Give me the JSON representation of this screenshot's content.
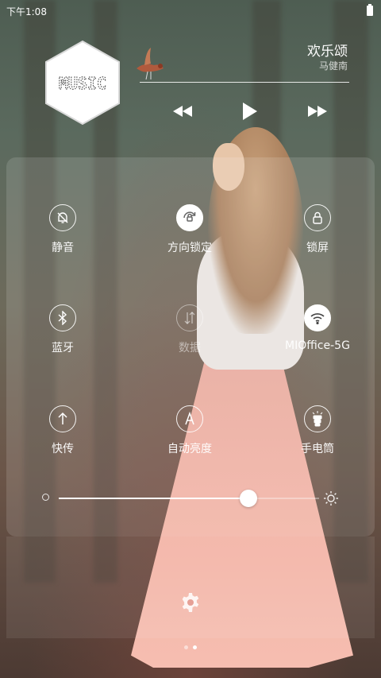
{
  "status_bar": {
    "time": "下午1:08"
  },
  "music": {
    "logo_text": "MUSIC",
    "title": "欢乐颂",
    "artist": "马健南",
    "controls": {
      "previous": "rewind-icon",
      "play": "play-icon",
      "next": "fast-forward-icon"
    }
  },
  "toggles": [
    {
      "label": "静音",
      "icon": "bell-mute-icon",
      "state": "off"
    },
    {
      "label": "方向锁定",
      "icon": "rotation-lock-icon",
      "state": "on"
    },
    {
      "label": "锁屏",
      "icon": "lock-icon",
      "state": "off"
    },
    {
      "label": "蓝牙",
      "icon": "bluetooth-icon",
      "state": "off"
    },
    {
      "label": "数据",
      "icon": "mobile-data-icon",
      "state": "disabled"
    },
    {
      "label": "MIOffice-5G",
      "icon": "wifi-icon",
      "state": "on"
    },
    {
      "label": "快传",
      "icon": "quick-share-icon",
      "state": "off"
    },
    {
      "label": "自动亮度",
      "icon": "auto-brightness-icon",
      "state": "off"
    },
    {
      "label": "手电筒",
      "icon": "flashlight-icon",
      "state": "off"
    }
  ],
  "brightness": {
    "value_fraction": 0.73
  },
  "page_indicator": {
    "count": 2,
    "current": 2
  },
  "colors": {
    "panel_overlay": "#ffffff",
    "text": "#ffffff"
  }
}
